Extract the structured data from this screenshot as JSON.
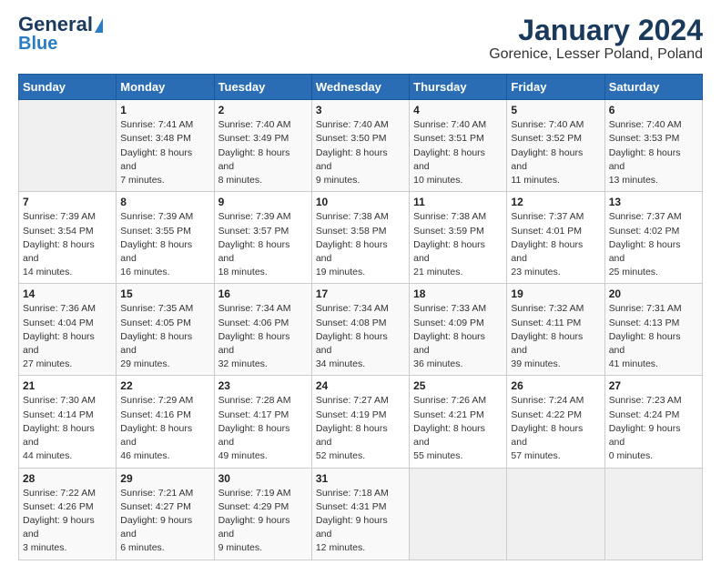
{
  "header": {
    "logo_line1": "General",
    "logo_line2": "Blue",
    "title": "January 2024",
    "subtitle": "Gorenice, Lesser Poland, Poland"
  },
  "calendar": {
    "days_of_week": [
      "Sunday",
      "Monday",
      "Tuesday",
      "Wednesday",
      "Thursday",
      "Friday",
      "Saturday"
    ],
    "weeks": [
      [
        {
          "day": "",
          "sunrise": "",
          "sunset": "",
          "daylight": ""
        },
        {
          "day": "1",
          "sunrise": "Sunrise: 7:41 AM",
          "sunset": "Sunset: 3:48 PM",
          "daylight": "Daylight: 8 hours and 7 minutes."
        },
        {
          "day": "2",
          "sunrise": "Sunrise: 7:40 AM",
          "sunset": "Sunset: 3:49 PM",
          "daylight": "Daylight: 8 hours and 8 minutes."
        },
        {
          "day": "3",
          "sunrise": "Sunrise: 7:40 AM",
          "sunset": "Sunset: 3:50 PM",
          "daylight": "Daylight: 8 hours and 9 minutes."
        },
        {
          "day": "4",
          "sunrise": "Sunrise: 7:40 AM",
          "sunset": "Sunset: 3:51 PM",
          "daylight": "Daylight: 8 hours and 10 minutes."
        },
        {
          "day": "5",
          "sunrise": "Sunrise: 7:40 AM",
          "sunset": "Sunset: 3:52 PM",
          "daylight": "Daylight: 8 hours and 11 minutes."
        },
        {
          "day": "6",
          "sunrise": "Sunrise: 7:40 AM",
          "sunset": "Sunset: 3:53 PM",
          "daylight": "Daylight: 8 hours and 13 minutes."
        }
      ],
      [
        {
          "day": "7",
          "sunrise": "Sunrise: 7:39 AM",
          "sunset": "Sunset: 3:54 PM",
          "daylight": "Daylight: 8 hours and 14 minutes."
        },
        {
          "day": "8",
          "sunrise": "Sunrise: 7:39 AM",
          "sunset": "Sunset: 3:55 PM",
          "daylight": "Daylight: 8 hours and 16 minutes."
        },
        {
          "day": "9",
          "sunrise": "Sunrise: 7:39 AM",
          "sunset": "Sunset: 3:57 PM",
          "daylight": "Daylight: 8 hours and 18 minutes."
        },
        {
          "day": "10",
          "sunrise": "Sunrise: 7:38 AM",
          "sunset": "Sunset: 3:58 PM",
          "daylight": "Daylight: 8 hours and 19 minutes."
        },
        {
          "day": "11",
          "sunrise": "Sunrise: 7:38 AM",
          "sunset": "Sunset: 3:59 PM",
          "daylight": "Daylight: 8 hours and 21 minutes."
        },
        {
          "day": "12",
          "sunrise": "Sunrise: 7:37 AM",
          "sunset": "Sunset: 4:01 PM",
          "daylight": "Daylight: 8 hours and 23 minutes."
        },
        {
          "day": "13",
          "sunrise": "Sunrise: 7:37 AM",
          "sunset": "Sunset: 4:02 PM",
          "daylight": "Daylight: 8 hours and 25 minutes."
        }
      ],
      [
        {
          "day": "14",
          "sunrise": "Sunrise: 7:36 AM",
          "sunset": "Sunset: 4:04 PM",
          "daylight": "Daylight: 8 hours and 27 minutes."
        },
        {
          "day": "15",
          "sunrise": "Sunrise: 7:35 AM",
          "sunset": "Sunset: 4:05 PM",
          "daylight": "Daylight: 8 hours and 29 minutes."
        },
        {
          "day": "16",
          "sunrise": "Sunrise: 7:34 AM",
          "sunset": "Sunset: 4:06 PM",
          "daylight": "Daylight: 8 hours and 32 minutes."
        },
        {
          "day": "17",
          "sunrise": "Sunrise: 7:34 AM",
          "sunset": "Sunset: 4:08 PM",
          "daylight": "Daylight: 8 hours and 34 minutes."
        },
        {
          "day": "18",
          "sunrise": "Sunrise: 7:33 AM",
          "sunset": "Sunset: 4:09 PM",
          "daylight": "Daylight: 8 hours and 36 minutes."
        },
        {
          "day": "19",
          "sunrise": "Sunrise: 7:32 AM",
          "sunset": "Sunset: 4:11 PM",
          "daylight": "Daylight: 8 hours and 39 minutes."
        },
        {
          "day": "20",
          "sunrise": "Sunrise: 7:31 AM",
          "sunset": "Sunset: 4:13 PM",
          "daylight": "Daylight: 8 hours and 41 minutes."
        }
      ],
      [
        {
          "day": "21",
          "sunrise": "Sunrise: 7:30 AM",
          "sunset": "Sunset: 4:14 PM",
          "daylight": "Daylight: 8 hours and 44 minutes."
        },
        {
          "day": "22",
          "sunrise": "Sunrise: 7:29 AM",
          "sunset": "Sunset: 4:16 PM",
          "daylight": "Daylight: 8 hours and 46 minutes."
        },
        {
          "day": "23",
          "sunrise": "Sunrise: 7:28 AM",
          "sunset": "Sunset: 4:17 PM",
          "daylight": "Daylight: 8 hours and 49 minutes."
        },
        {
          "day": "24",
          "sunrise": "Sunrise: 7:27 AM",
          "sunset": "Sunset: 4:19 PM",
          "daylight": "Daylight: 8 hours and 52 minutes."
        },
        {
          "day": "25",
          "sunrise": "Sunrise: 7:26 AM",
          "sunset": "Sunset: 4:21 PM",
          "daylight": "Daylight: 8 hours and 55 minutes."
        },
        {
          "day": "26",
          "sunrise": "Sunrise: 7:24 AM",
          "sunset": "Sunset: 4:22 PM",
          "daylight": "Daylight: 8 hours and 57 minutes."
        },
        {
          "day": "27",
          "sunrise": "Sunrise: 7:23 AM",
          "sunset": "Sunset: 4:24 PM",
          "daylight": "Daylight: 9 hours and 0 minutes."
        }
      ],
      [
        {
          "day": "28",
          "sunrise": "Sunrise: 7:22 AM",
          "sunset": "Sunset: 4:26 PM",
          "daylight": "Daylight: 9 hours and 3 minutes."
        },
        {
          "day": "29",
          "sunrise": "Sunrise: 7:21 AM",
          "sunset": "Sunset: 4:27 PM",
          "daylight": "Daylight: 9 hours and 6 minutes."
        },
        {
          "day": "30",
          "sunrise": "Sunrise: 7:19 AM",
          "sunset": "Sunset: 4:29 PM",
          "daylight": "Daylight: 9 hours and 9 minutes."
        },
        {
          "day": "31",
          "sunrise": "Sunrise: 7:18 AM",
          "sunset": "Sunset: 4:31 PM",
          "daylight": "Daylight: 9 hours and 12 minutes."
        },
        {
          "day": "",
          "sunrise": "",
          "sunset": "",
          "daylight": ""
        },
        {
          "day": "",
          "sunrise": "",
          "sunset": "",
          "daylight": ""
        },
        {
          "day": "",
          "sunrise": "",
          "sunset": "",
          "daylight": ""
        }
      ]
    ]
  }
}
